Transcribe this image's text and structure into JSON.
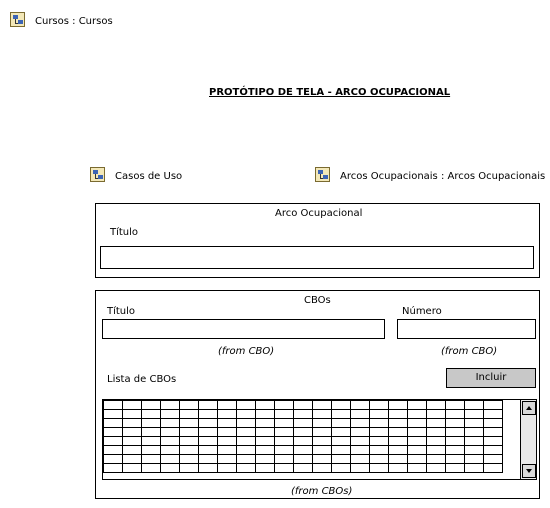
{
  "header": {
    "breadcrumb": "Cursos : Cursos"
  },
  "title": "PROTÓTIPO DE TELA - ARCO OCUPACIONAL",
  "links": {
    "use_cases": "Casos de Uso",
    "arcos": "Arcos Ocupacionais : Arcos Ocupacionais"
  },
  "arco_panel": {
    "heading": "Arco Ocupacional",
    "titulo_label": "Título",
    "titulo_value": ""
  },
  "cbos_panel": {
    "heading": "CBOs",
    "titulo_label": "Título",
    "numero_label": "Número",
    "titulo_value": "",
    "numero_value": "",
    "from_titulo": "(from CBO)",
    "from_numero": "(from CBO)",
    "list_label": "Lista de CBOs",
    "include_button": "Incluir",
    "from_list": "(from CBOs)"
  },
  "icons": {
    "breadcrumb_icon": "diagram-icon",
    "use_cases_icon": "diagram-icon",
    "arcos_icon": "diagram-icon",
    "scroll_up": "scroll-up-arrow-icon",
    "scroll_down": "scroll-down-arrow-icon"
  }
}
